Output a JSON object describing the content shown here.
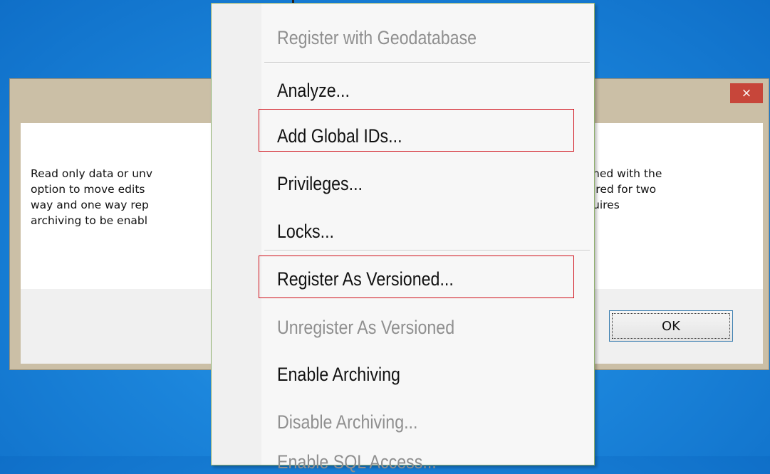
{
  "dialog": {
    "close_symbol": "×",
    "message_left": [
      "Read only data or unv",
      "option to move edits",
      "way and one way rep",
      "archiving to be enabl"
    ],
    "message_right": [
      "ned with the",
      "ired for two",
      "uires",
      ""
    ],
    "ok_label": "OK"
  },
  "menu": {
    "items": [
      {
        "label": "Register with Geodatabase",
        "enabled": false
      },
      {
        "label": "Analyze...",
        "enabled": true
      },
      {
        "label": "Add Global IDs...",
        "enabled": true,
        "highlighted": true
      },
      {
        "label": "Privileges...",
        "enabled": true
      },
      {
        "label": "Locks...",
        "enabled": true
      },
      {
        "label": "Register As Versioned...",
        "enabled": true,
        "highlighted": true
      },
      {
        "label": "Unregister As Versioned",
        "enabled": false
      },
      {
        "label": "Enable Archiving",
        "enabled": true
      },
      {
        "label": "Disable Archiving...",
        "enabled": false
      },
      {
        "label": "Enable SQL Access...",
        "enabled": false
      }
    ]
  },
  "colors": {
    "desktop": "#1c86dc",
    "highlight_box": "#d0101a",
    "close_button": "#c7463a"
  }
}
